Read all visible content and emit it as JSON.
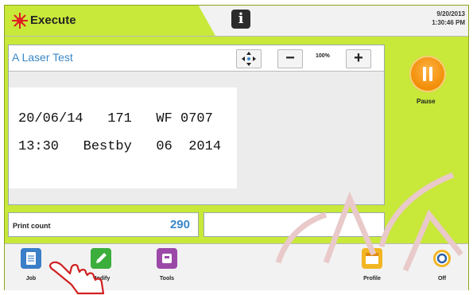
{
  "header": {
    "title": "Execute",
    "date": "9/20/2013",
    "time": "1:30:46 PM",
    "info_icon": "info-icon"
  },
  "job": {
    "name": "A Laser Test",
    "zoom": "100%",
    "label_lines": [
      "20/06/14   171   WF 0707",
      "13:30   Bestby   06  2014"
    ]
  },
  "pause": {
    "label": "Pause"
  },
  "print_count": {
    "label": "Print count",
    "value": "290"
  },
  "bottom_bar": {
    "job": "Job",
    "modify": "Modify",
    "tools": "Tools",
    "profile": "Profile",
    "off": "Off"
  },
  "colors": {
    "accent_green": "#c8e83a",
    "blue_text": "#3a87c8",
    "pause_orange": "#f08a00"
  }
}
